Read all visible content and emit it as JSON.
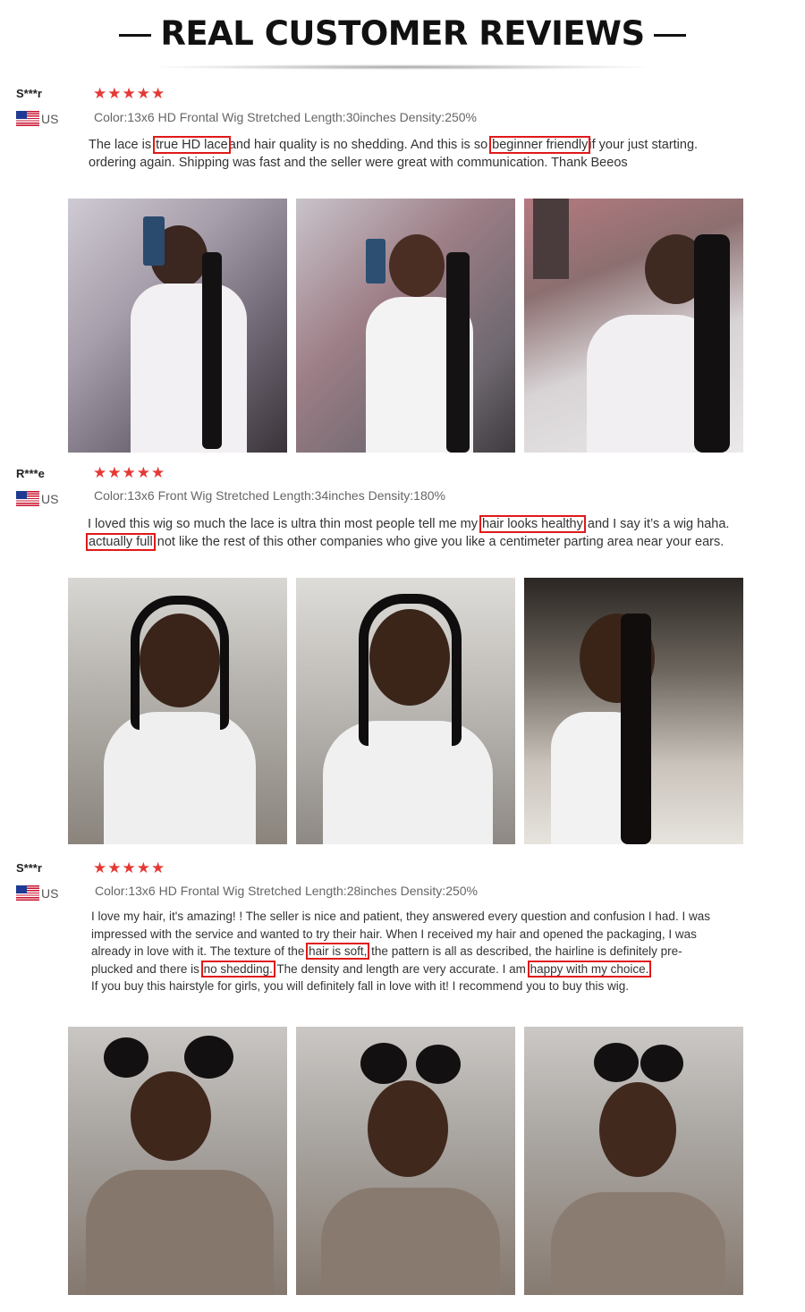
{
  "header": {
    "title": "REAL CUSTOMER REVIEWS"
  },
  "reviews": [
    {
      "user": "S***r",
      "country": "US",
      "rating": 5,
      "stars": "★★★★★",
      "spec": "Color:13x6 HD Frontal Wig Stretched Length:30inches Density:250%",
      "text": {
        "l1a": "The lace is ",
        "h1": "true HD lace",
        "l1b": "and hair quality is no shedding. And this is so ",
        "h2": "beginner friendly",
        "l1c": "if your just starting.",
        "l2": "ordering again. Shipping was fast and the seller were great with communication. Thank Beeos"
      },
      "photos": [
        "customer-photo-selfie-mirror",
        "customer-photo-selfie-mirror-smile",
        "customer-photo-selfie-pose"
      ]
    },
    {
      "user": "R***e",
      "country": "US",
      "rating": 5,
      "stars": "★★★★★",
      "spec": "Color:13x6 Front Wig Stretched Length:34inches Density:180%",
      "text": {
        "l1a": "I loved this wig so much the lace is ultra thin most people tell me my ",
        "h1": "hair looks healthy",
        "l1b": " and I say it’s a wig haha.",
        "h2": "actually full",
        "l2b": "  not like the rest of this other companies who give you like a centimeter parting area near your ears."
      },
      "photos": [
        "customer-photo-selfie-white-top",
        "customer-photo-selfie-front",
        "customer-photo-selfie-kitchen"
      ]
    },
    {
      "user": "S***r",
      "country": "US",
      "rating": 5,
      "stars": "★★★★★",
      "spec": "Color:13x6 HD Frontal Wig Stretched Length:28inches Density:250%",
      "text": {
        "l1": "I love my hair, it's amazing! ! The seller is nice and patient, they answered every question and confusion I had. I was",
        "l2": "impressed with the service and wanted to try their hair. When I received my hair and opened the packaging, I was",
        "l3a": "already in love with it. The texture of the ",
        "h1": "hair is soft,",
        "l3b": " the pattern is all as described, the hairline is definitely pre-",
        "l4a": "plucked and there is ",
        "h2": "no shedding.",
        "l4b": " The density and length are very accurate. I am ",
        "h3": "happy with my choice.",
        "l5": "If you buy this hairstyle for girls, you will definitely fall in love with it! I recommend you to buy this wig."
      },
      "photos": [
        "customer-photo-buns-looking-down",
        "customer-photo-buns-front",
        "customer-photo-buns-smile"
      ]
    }
  ],
  "colors": {
    "star": "#e53935",
    "highlight_border": "#e01919",
    "title": "#111111"
  }
}
